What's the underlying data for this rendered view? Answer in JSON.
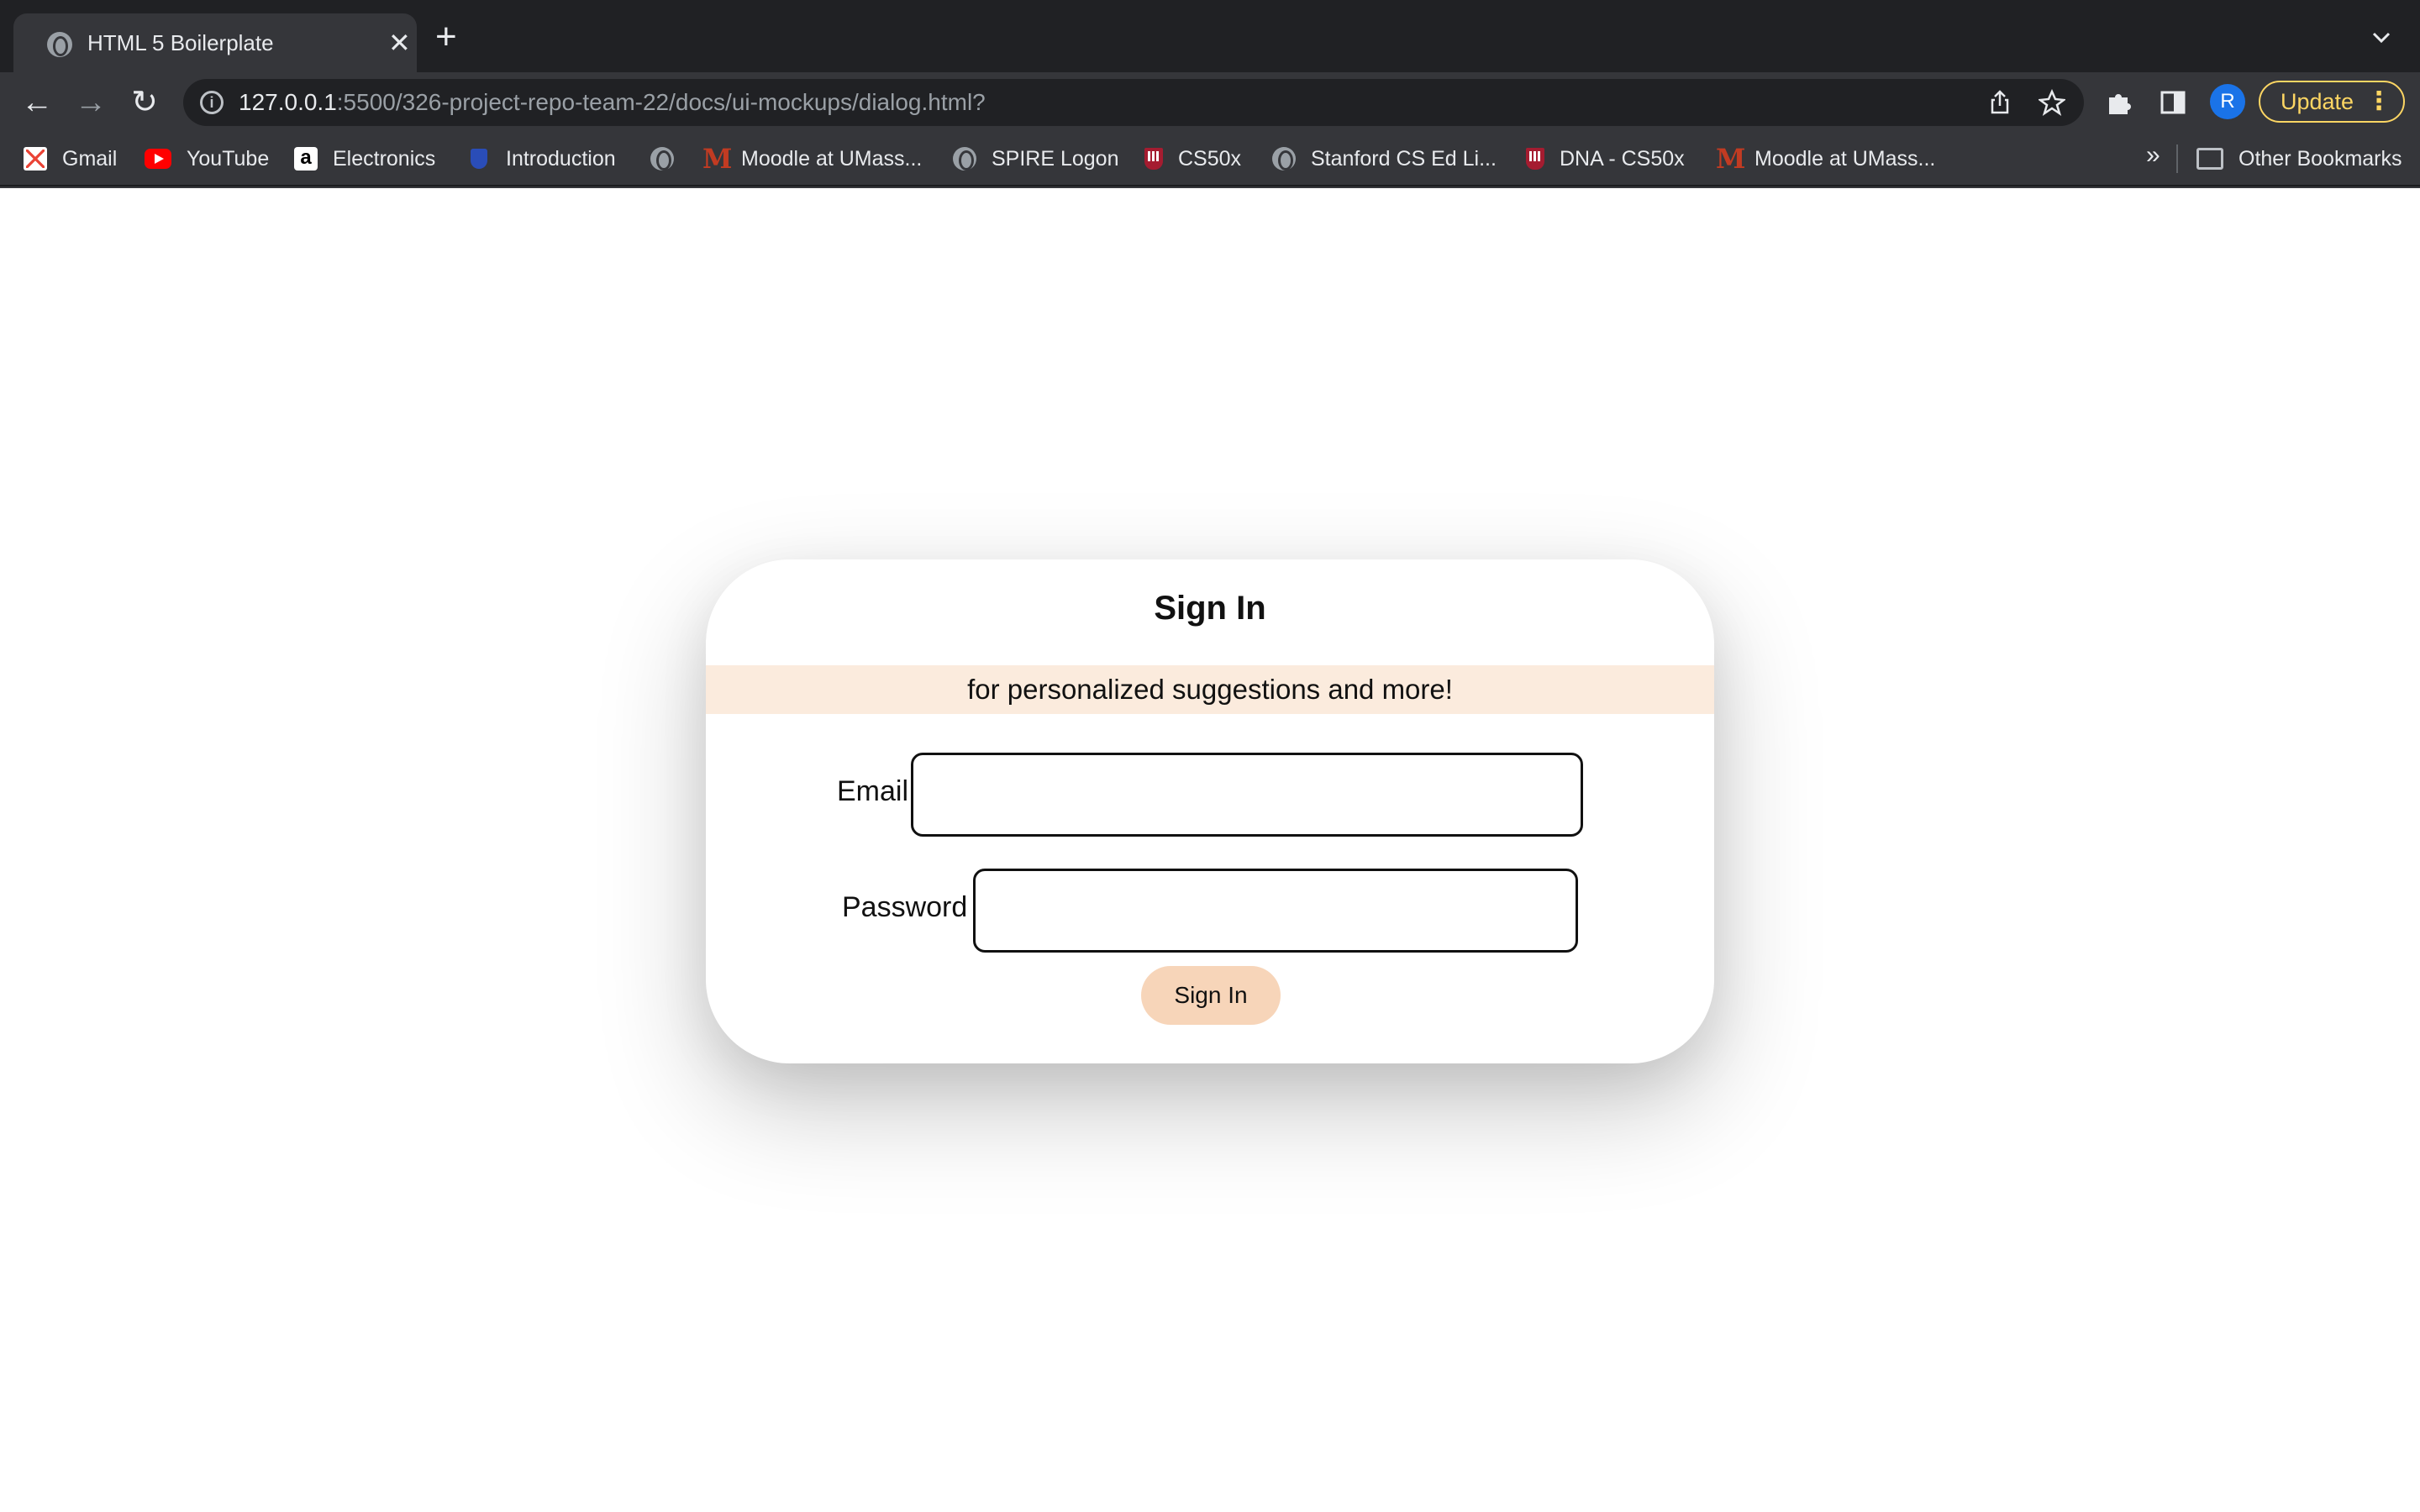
{
  "browser": {
    "tab": {
      "title": "HTML 5 Boilerplate",
      "close": "✕"
    },
    "new_tab": "+",
    "nav": {
      "back": "←",
      "forward": "→",
      "reload": "↻"
    },
    "address": {
      "host": "127.0.0.1",
      "rest": ":5500/326-project-repo-team-22/docs/ui-mockups/dialog.html?"
    },
    "profile_initial": "R",
    "update_label": "Update",
    "bookmarks": [
      {
        "label": "Gmail",
        "icon": "gmail-icon"
      },
      {
        "label": "YouTube",
        "icon": "youtube-icon"
      },
      {
        "label": "Electronics",
        "icon": "amazon-icon"
      },
      {
        "label": "Introduction",
        "icon": "introduction-icon"
      },
      {
        "label": "",
        "icon": "globe-icon"
      },
      {
        "label": "Moodle at UMass...",
        "icon": "moodle-icon"
      },
      {
        "label": "SPIRE Logon",
        "icon": "globe-icon"
      },
      {
        "label": "CS50x",
        "icon": "harvard-icon"
      },
      {
        "label": "Stanford CS Ed Li...",
        "icon": "globe-icon"
      },
      {
        "label": "DNA - CS50x",
        "icon": "harvard-icon"
      },
      {
        "label": "Moodle at UMass...",
        "icon": "moodle-icon"
      }
    ],
    "bookmarks_overflow": "»",
    "other_bookmarks": "Other Bookmarks"
  },
  "dialog": {
    "title": "Sign In",
    "subtitle": "for personalized suggestions and more!",
    "email_label": "Email",
    "email_value": "",
    "password_label": "Password",
    "password_value": "",
    "submit_label": "Sign In"
  },
  "colors": {
    "banner_bg": "#fbebdd",
    "button_bg": "#f7d5b9",
    "update_accent": "#fdd663",
    "avatar_bg": "#1a73e8"
  }
}
